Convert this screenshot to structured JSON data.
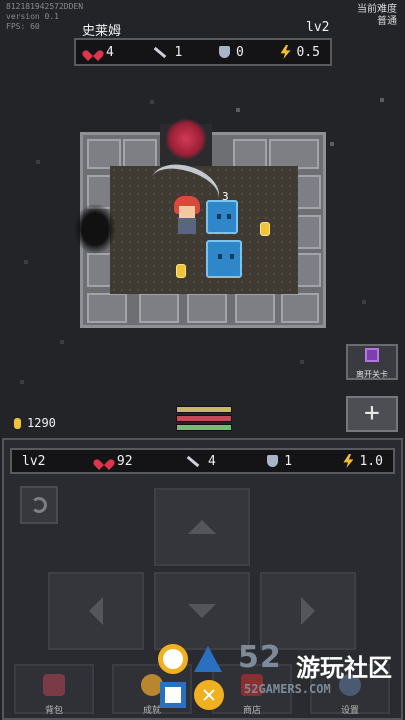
{
  "debug": {
    "line1": "812181942572DDEN",
    "line2": "version 0.1",
    "line3": "FPS: 60"
  },
  "difficulty": {
    "label": "当前难度",
    "value": "普通"
  },
  "enemy": {
    "name": "史莱姆",
    "level": "lv2",
    "hp": "4",
    "attack": "1",
    "defense": "0",
    "speed": "0.5"
  },
  "battle": {
    "damage_number": "3"
  },
  "leave_button": {
    "label": "离开关卡"
  },
  "plus_button": {
    "label": "+"
  },
  "gold": {
    "amount": "1290"
  },
  "player": {
    "level": "lv2",
    "hp": "92",
    "attack": "4",
    "defense": "1",
    "speed": "1.0"
  },
  "bottom_nav": [
    {
      "label": "背包",
      "icon": "backpack-icon"
    },
    {
      "label": "成就",
      "icon": "medal-icon"
    },
    {
      "label": "商店",
      "icon": "cart-icon"
    },
    {
      "label": "设置",
      "icon": "gear-icon"
    }
  ],
  "watermark": {
    "number": "52",
    "chinese": "游玩社区",
    "domain": "52GAMERS.COM"
  },
  "colors": {
    "hp": "#e0344d",
    "gold": "#f0c43a",
    "slime": "#2f86c8",
    "bolt": "#f2c031",
    "panel": "#2a2b30"
  }
}
